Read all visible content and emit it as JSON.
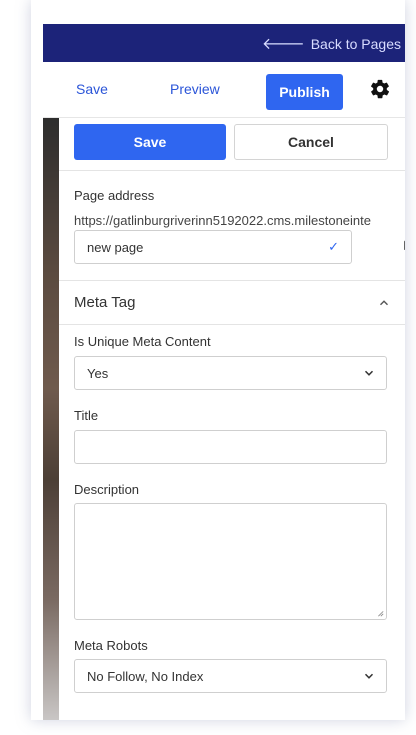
{
  "topbar": {
    "back_label": "Back to Pages"
  },
  "toolbar": {
    "save_label": "Save",
    "preview_label": "Preview",
    "publish_label": "Publish"
  },
  "form": {
    "save_label": "Save",
    "cancel_label": "Cancel",
    "page_address_label": "Page address",
    "page_address_url": "https://gatlinburgriverinn5192022.cms.milestoneinte",
    "page_name_value": "new page",
    "meta_section_title": "Meta Tag",
    "unique_meta_label": "Is Unique Meta Content",
    "unique_meta_value": "Yes",
    "title_label": "Title",
    "title_value": "",
    "description_label": "Description",
    "description_value": "",
    "robots_label": "Meta Robots",
    "robots_value": "No Follow, No Index"
  },
  "colors": {
    "topbar": "#1c2379",
    "accent": "#2f66f0",
    "link": "#2b55d8"
  },
  "icons": [
    "back-arrow-icon",
    "gear-icon",
    "check-icon",
    "copy-icon",
    "chevron-up-icon",
    "chevron-down-icon",
    "resize-handle-icon"
  ]
}
